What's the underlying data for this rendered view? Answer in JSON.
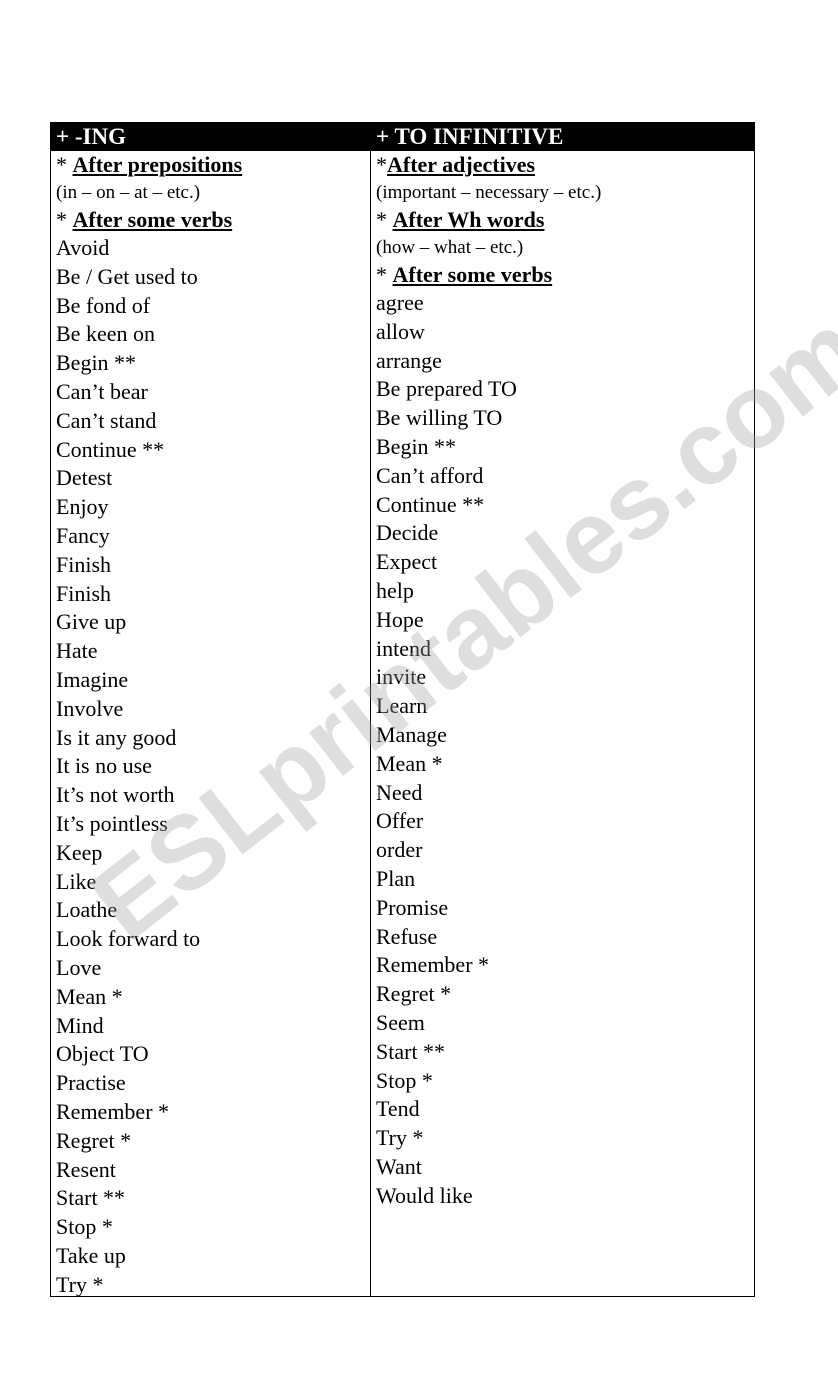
{
  "headers": [
    "+ -ING",
    "+ TO INFINITIVE"
  ],
  "left": {
    "sections": [
      {
        "star": "* ",
        "title": "After prepositions",
        "note": "(in – on – at – etc.)"
      },
      {
        "star": "* ",
        "title": "After some verbs"
      }
    ],
    "items": [
      "Avoid",
      "Be / Get used to",
      "Be fond of",
      "Be keen on",
      "Begin **",
      "Can’t bear",
      "Can’t stand",
      "Continue **",
      "Detest",
      "Enjoy",
      "Fancy",
      "Finish",
      "Finish",
      "Give up",
      "Hate",
      "Imagine",
      "Involve",
      "Is it any good",
      "It is no use",
      "It’s not worth",
      "It’s pointless",
      "Keep",
      "Like",
      "Loathe",
      "Look forward to",
      "Love",
      "Mean *",
      "Mind",
      "Object TO",
      "Practise",
      "Remember *",
      "Regret *",
      "Resent",
      "Start **",
      "Stop *",
      "Take up",
      "Try *"
    ]
  },
  "right": {
    "sections": [
      {
        "star": "*",
        "title": "After adjectives",
        "note": "(important – necessary – etc.)"
      },
      {
        "star": "* ",
        "title": "After Wh words",
        "note": "(how – what – etc.)"
      },
      {
        "star": "* ",
        "title": "After some verbs"
      }
    ],
    "items": [
      "agree",
      "allow",
      "arrange",
      "Be prepared TO",
      "Be willing TO",
      "Begin **",
      "Can’t afford",
      "Continue **",
      "Decide",
      "Expect",
      "help",
      "Hope",
      "intend",
      "invite",
      "Learn",
      "Manage",
      "Mean *",
      "Need",
      "Offer",
      "order",
      "Plan",
      "Promise",
      "Refuse",
      "Remember *",
      "Regret *",
      "Seem",
      "Start **",
      "Stop *",
      "Tend",
      "Try *",
      "Want",
      "Would like"
    ]
  },
  "watermark": "ESLprintables.com"
}
